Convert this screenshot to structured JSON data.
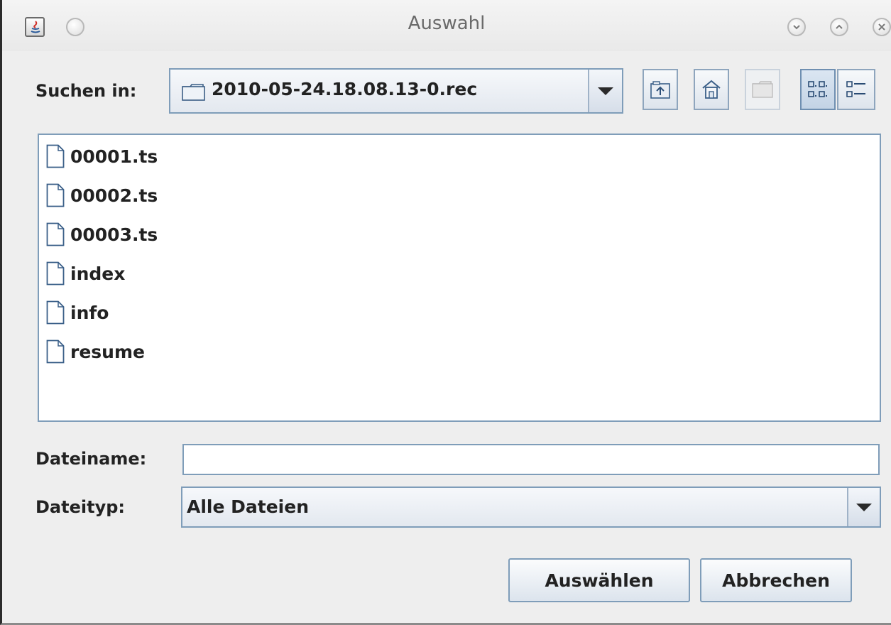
{
  "window": {
    "title": "Auswahl"
  },
  "toolbar": {
    "look_in_label": "Suchen in:",
    "look_in_value": "2010-05-24.18.08.13-0.rec",
    "buttons": [
      {
        "name": "up-one-level",
        "icon": "folder-up-icon"
      },
      {
        "name": "home",
        "icon": "home-icon"
      },
      {
        "name": "new-folder",
        "icon": "new-folder-icon",
        "disabled": true
      },
      {
        "name": "list-view",
        "icon": "list-view-icon",
        "active": true
      },
      {
        "name": "details-view",
        "icon": "details-view-icon"
      }
    ]
  },
  "files": [
    {
      "name": "00001.ts"
    },
    {
      "name": "00002.ts"
    },
    {
      "name": "00003.ts"
    },
    {
      "name": "index"
    },
    {
      "name": "info"
    },
    {
      "name": "resume"
    }
  ],
  "filename": {
    "label": "Dateiname:",
    "value": ""
  },
  "filetype": {
    "label": "Dateityp:",
    "value": "Alle Dateien"
  },
  "actions": {
    "approve_label": "Auswählen",
    "cancel_label": "Abbrechen"
  },
  "colors": {
    "border_accent": "#7f9db9",
    "window_bg": "#eeeeee"
  }
}
